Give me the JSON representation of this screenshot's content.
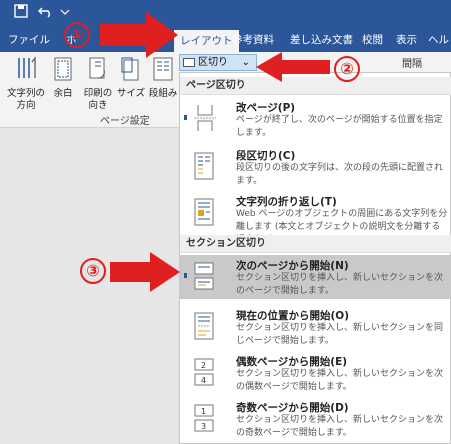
{
  "quick_access": {
    "save_icon": "save-icon",
    "undo_icon": "undo-icon"
  },
  "tabs": [
    {
      "label": "ファイル"
    },
    {
      "label": "ホ"
    },
    {
      "label": "挿"
    },
    {
      "label": "ン"
    },
    {
      "label": "レイアウト"
    },
    {
      "label": "参考資料"
    },
    {
      "label": "差し込み文書"
    },
    {
      "label": "校閲"
    },
    {
      "label": "表示"
    },
    {
      "label": "ヘル"
    }
  ],
  "ribbon": {
    "buttons": [
      {
        "label": "文字列の\n方向"
      },
      {
        "label": "余白"
      },
      {
        "label": "印刷の\n向き"
      },
      {
        "label": "サイズ"
      },
      {
        "label": "段組み"
      }
    ],
    "group_label": "ページ設定",
    "break_button": "区切り",
    "spacing_label": "間隔"
  },
  "menu": {
    "page_section_header": "ページ区切り",
    "section_header": "セクション区切り",
    "items": [
      {
        "title": "改ページ(P)",
        "desc": "ページが終了し、次のページが開始する位置を指定します。"
      },
      {
        "title": "段区切り(C)",
        "desc": "段区切りの後の文字列は、次の段の先頭に配置されます。"
      },
      {
        "title": "文字列の折り返し(T)",
        "desc": "Web ページのオブジェクトの周囲にある文字列を分離します (本文とオブジェクトの説明文を分離する場合など)。"
      },
      {
        "title": "次のページから開始(N)",
        "desc": "セクション区切りを挿入し、新しいセクションを次のページで開始します。"
      },
      {
        "title": "現在の位置から開始(O)",
        "desc": "セクション区切りを挿入し、新しいセクションを同じページで開始します。"
      },
      {
        "title": "偶数ページから開始(E)",
        "desc": "セクション区切りを挿入し、新しいセクションを次の偶数ページで開始します。"
      },
      {
        "title": "奇数ページから開始(D)",
        "desc": "セクション区切りを挿入し、新しいセクションを次の奇数ページで開始します。"
      }
    ]
  },
  "annotations": {
    "one": "①",
    "two": "②",
    "three": "③"
  },
  "colors": {
    "ribbon_blue": "#2b579a",
    "annotation_red": "#e02020",
    "selected_item": "#c9c9c9"
  }
}
